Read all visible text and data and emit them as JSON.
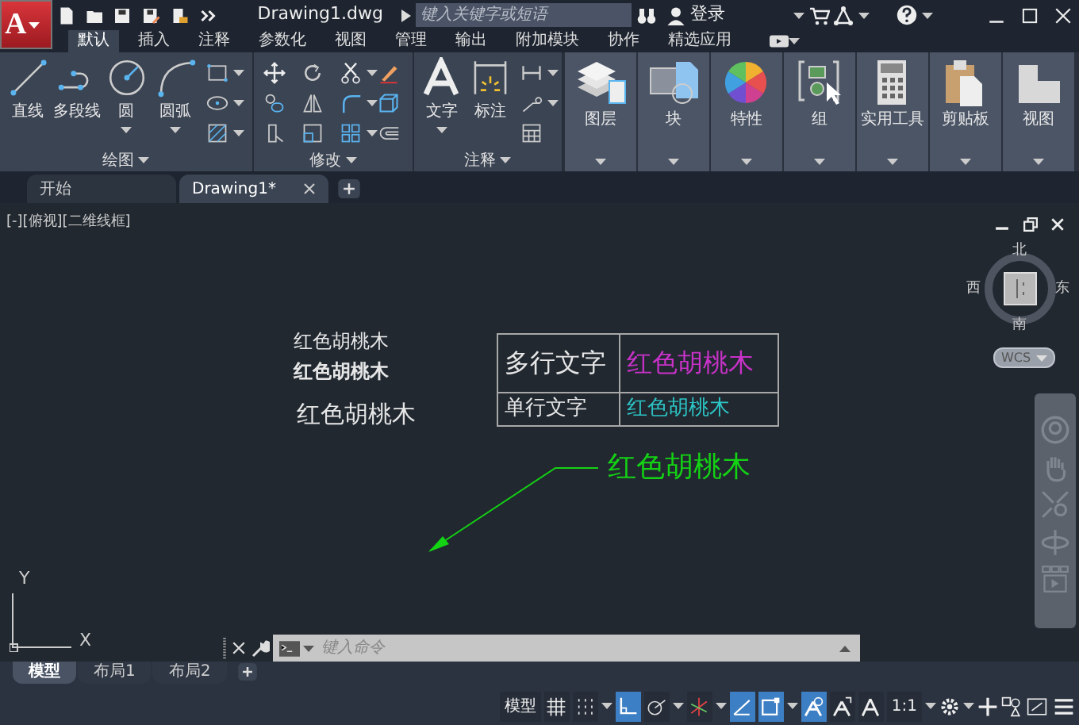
{
  "app_button": {
    "label": "A"
  },
  "window": {
    "title": "Drawing1.dwg"
  },
  "search": {
    "placeholder": "键入关键字或短语"
  },
  "account": {
    "label": "登录"
  },
  "ribbon_tabs": [
    {
      "label": "默认",
      "selected": true
    },
    {
      "label": "插入",
      "selected": false
    },
    {
      "label": "注释",
      "selected": false
    },
    {
      "label": "参数化",
      "selected": false
    },
    {
      "label": "视图",
      "selected": false
    },
    {
      "label": "管理",
      "selected": false
    },
    {
      "label": "输出",
      "selected": false
    },
    {
      "label": "附加模块",
      "selected": false
    },
    {
      "label": "协作",
      "selected": false
    },
    {
      "label": "精选应用",
      "selected": false
    }
  ],
  "ribbon_panels": [
    {
      "title": "绘图",
      "tools": [
        {
          "label": "直线",
          "dropdown": false
        },
        {
          "label": "多段线",
          "dropdown": false
        },
        {
          "label": "圆",
          "dropdown": true
        },
        {
          "label": "圆弧",
          "dropdown": true
        }
      ]
    },
    {
      "title": "修改"
    },
    {
      "title": "注释",
      "tools": [
        {
          "label": "文字",
          "dropdown": true
        },
        {
          "label": "标注",
          "dropdown": false
        }
      ]
    }
  ],
  "ribbon_buttons": [
    {
      "label": "图层"
    },
    {
      "label": "块"
    },
    {
      "label": "特性"
    },
    {
      "label": "组"
    },
    {
      "label": "实用工具"
    },
    {
      "label": "剪贴板"
    },
    {
      "label": "视图"
    }
  ],
  "file_tabs": [
    {
      "label": "开始",
      "selected": false,
      "closable": false
    },
    {
      "label": "Drawing1*",
      "selected": true,
      "closable": true
    }
  ],
  "viewport": {
    "label": "[-][俯视][二维线框]"
  },
  "viewcube": {
    "north": "北",
    "south": "南",
    "west": "西",
    "east": "东",
    "ucs": "WCS"
  },
  "drawing": {
    "texts": [
      {
        "text": "红色胡桃木",
        "color": "#e6e6e6"
      },
      {
        "text": "红色胡桃木",
        "color": "#e6e6e6"
      },
      {
        "text": "红色胡桃木",
        "color": "#e6e6e6"
      }
    ],
    "table": {
      "rows": [
        {
          "label": "多行文字",
          "value": "红色胡桃木",
          "color": "#c832c8"
        },
        {
          "label": "单行文字",
          "value": "红色胡桃木",
          "color": "#2cc4c4"
        }
      ]
    },
    "leader": {
      "text": "红色胡桃木",
      "color": "#14d214"
    },
    "axes": {
      "x": "X",
      "y": "Y"
    }
  },
  "command_line": {
    "placeholder": "键入命令"
  },
  "layout_tabs": [
    {
      "label": "模型",
      "selected": true
    },
    {
      "label": "布局1",
      "selected": false
    },
    {
      "label": "布局2",
      "selected": false
    }
  ],
  "status_bar": {
    "model": "模型",
    "scale": "1:1",
    "toggles": [
      {
        "kind": "grid",
        "on": false
      },
      {
        "kind": "snap",
        "on": false
      },
      {
        "kind": "ortho",
        "on": true
      },
      {
        "kind": "polar",
        "on": false
      },
      {
        "kind": "isodraft",
        "on": false
      },
      {
        "kind": "tracking",
        "on": true
      },
      {
        "kind": "osnap",
        "on": true
      },
      {
        "kind": "annovisible",
        "on": true
      },
      {
        "kind": "autoscale",
        "on": false
      },
      {
        "kind": "annoscale",
        "on": false
      }
    ]
  }
}
